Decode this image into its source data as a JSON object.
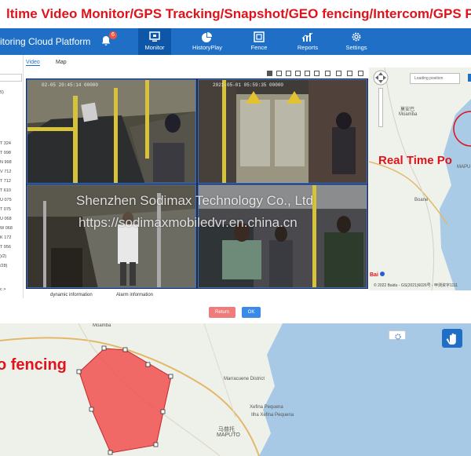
{
  "banner": {
    "title": "ltime Video Monitor/GPS Tracking/Snapshot/GEO fencing/Intercom/GPS Playback/Vise"
  },
  "navbar": {
    "brand": "itoring Cloud Platform",
    "badge": "6",
    "items": [
      {
        "label": "Monitor",
        "icon": "monitor-icon"
      },
      {
        "label": "HistoryPlay",
        "icon": "pie-chart-icon"
      },
      {
        "label": "Fence",
        "icon": "fence-icon"
      },
      {
        "label": "Reports",
        "icon": "bar-chart-icon"
      },
      {
        "label": "Settings",
        "icon": "gear-icon"
      }
    ]
  },
  "sidebar": {
    "items": [
      "5)",
      "T 324",
      "T 998",
      "N 998",
      "V 712",
      "T 712",
      "T 610",
      "U 075",
      "T 075",
      "U 068",
      "W 068",
      "K 172",
      "T 956",
      ")/2)",
      "/28)",
      "c >"
    ]
  },
  "tabs": {
    "video": "Video",
    "map": "Map"
  },
  "video": {
    "stamps": [
      "02-05 20:45:14 00000",
      "2021-05-01 05:59:35 00000",
      "",
      ""
    ],
    "watermark_line1": "Shenzhen Sodimax Technology Co., Ltd",
    "watermark_line2": "https://sodimaxmobiledvr.en.china.cn"
  },
  "map": {
    "loading": "Loading position",
    "labels": [
      "莫安巴",
      "Moamba",
      "Boane",
      "MAPU"
    ],
    "overlay": "Real Time Po",
    "footer": "© 2022 Baidu - GS(2021)6026号 - 甲测资字1111"
  },
  "bottom": {
    "dynamic": "dynamic information",
    "alarm": "Alarm information",
    "return": "Return",
    "ok": "OK"
  },
  "bigmap": {
    "overlay": "o fencing",
    "labels": [
      "Moamba",
      "Marracuene District",
      "Xefina Pequena",
      "Ilha Xefina Pequena",
      "马普托",
      "MAPUTO"
    ]
  },
  "colors": {
    "accent": "#1f6fc7",
    "alert": "#e0121b",
    "fence": "#f04b4b"
  }
}
